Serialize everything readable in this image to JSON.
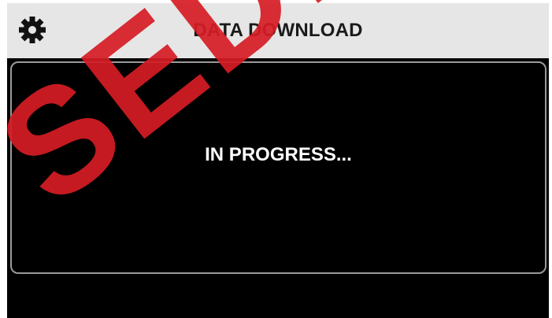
{
  "header": {
    "title": "DATA DOWNLOAD",
    "settings_icon": "gear-icon"
  },
  "panel": {
    "status_text": "IN PROGRESS..."
  },
  "watermark": {
    "text": "SEDE",
    "color": "#d61c24"
  },
  "colors": {
    "header_bg": "#e6e6e6",
    "screen_bg": "#000000",
    "panel_border": "#9a9a9a",
    "title_text": "#1a1a1a",
    "status_text": "#ffffff"
  }
}
